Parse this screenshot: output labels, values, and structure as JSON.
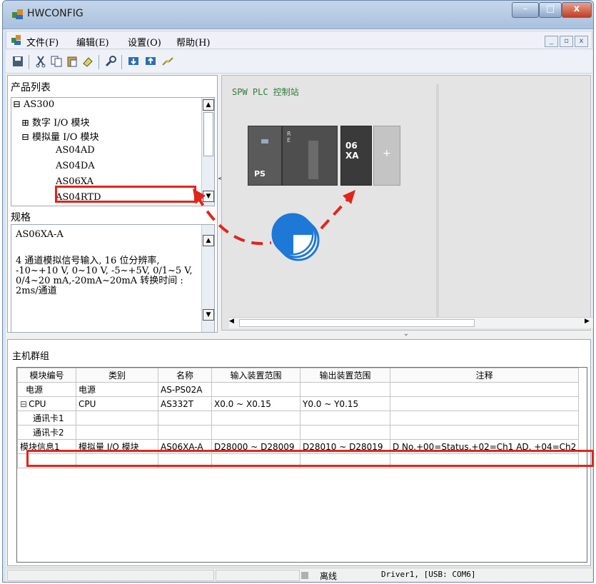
{
  "window": {
    "title": "HWCONFIG",
    "min": "–",
    "max": "□",
    "close": "x"
  },
  "menu": [
    {
      "label": "文件(F)"
    },
    {
      "label": "编辑(E)"
    },
    {
      "label": "设置(O)"
    },
    {
      "label": "帮助(H)"
    }
  ],
  "toolbar": {
    "icons": [
      "save-icon",
      "cut-icon",
      "copy-icon",
      "paste-icon",
      "eraser-icon",
      "wrench-icon",
      "download-icon",
      "upload-icon",
      "connect-icon"
    ]
  },
  "product_list": {
    "title": "产品列表",
    "tree": [
      {
        "label": "AS300",
        "toggle": "⊟"
      },
      {
        "label": "数字 I/O 模块",
        "toggle": "⊞"
      },
      {
        "label": "模拟量 I/O 模块",
        "toggle": "⊟"
      },
      {
        "label": "AS04AD"
      },
      {
        "label": "AS04DA"
      },
      {
        "label": "AS06XA"
      },
      {
        "label": "AS04RTD"
      }
    ]
  },
  "spec": {
    "label": "规格",
    "model": "AS06XA-A",
    "desc": "4 通道模拟信号输入, 16 位分辨率, -10~+10 V, 0~10 V, -5~+5V, 0/1~5 V, 0/4~20 mA,-20mA~20mA 转换时间 : 2ms/通道"
  },
  "station": {
    "title": "SPW PLC 控制站",
    "modules": [
      {
        "label": "PS"
      },
      {
        "label": "R\nE"
      },
      {
        "label": "06\nXA"
      },
      {
        "label": "+"
      }
    ]
  },
  "host_group": {
    "title": "主机群组",
    "columns": [
      "模块编号",
      "类别",
      "名称",
      "输入装置范围",
      "输出装置范围",
      "注释"
    ],
    "rows": [
      {
        "toggle": "",
        "id": "电源",
        "type": "电源",
        "name": "AS-PS02A",
        "input": "",
        "output": "",
        "note": ""
      },
      {
        "toggle": "⊟",
        "id": "CPU",
        "type": "CPU",
        "name": "AS332T",
        "input": "X0.0 ~ X0.15",
        "output": "Y0.0 ~ Y0.15",
        "note": ""
      },
      {
        "toggle": "",
        "id": "通讯卡1",
        "type": "",
        "name": "",
        "input": "",
        "output": "",
        "note": ""
      },
      {
        "toggle": "",
        "id": "通讯卡2",
        "type": "",
        "name": "",
        "input": "",
        "output": "",
        "note": ""
      },
      {
        "toggle": "",
        "id": "模块信息1",
        "type": "模拟量 I/O 模块",
        "name": "AS06XA-A",
        "input": "D28000 ~ D28009",
        "output": "D28010 ~ D28019",
        "note": "D No.+00=Status,+02=Ch1 AD, +04=Ch2"
      },
      {
        "toggle": "",
        "id": "",
        "type": "",
        "name": "",
        "input": "",
        "output": "",
        "note": ""
      }
    ]
  },
  "status": {
    "mode": "离线",
    "driver": "Driver1, [USB: COM6]"
  },
  "colors": {
    "highlight": "#e0261b",
    "pointer": "#1d78d6"
  }
}
